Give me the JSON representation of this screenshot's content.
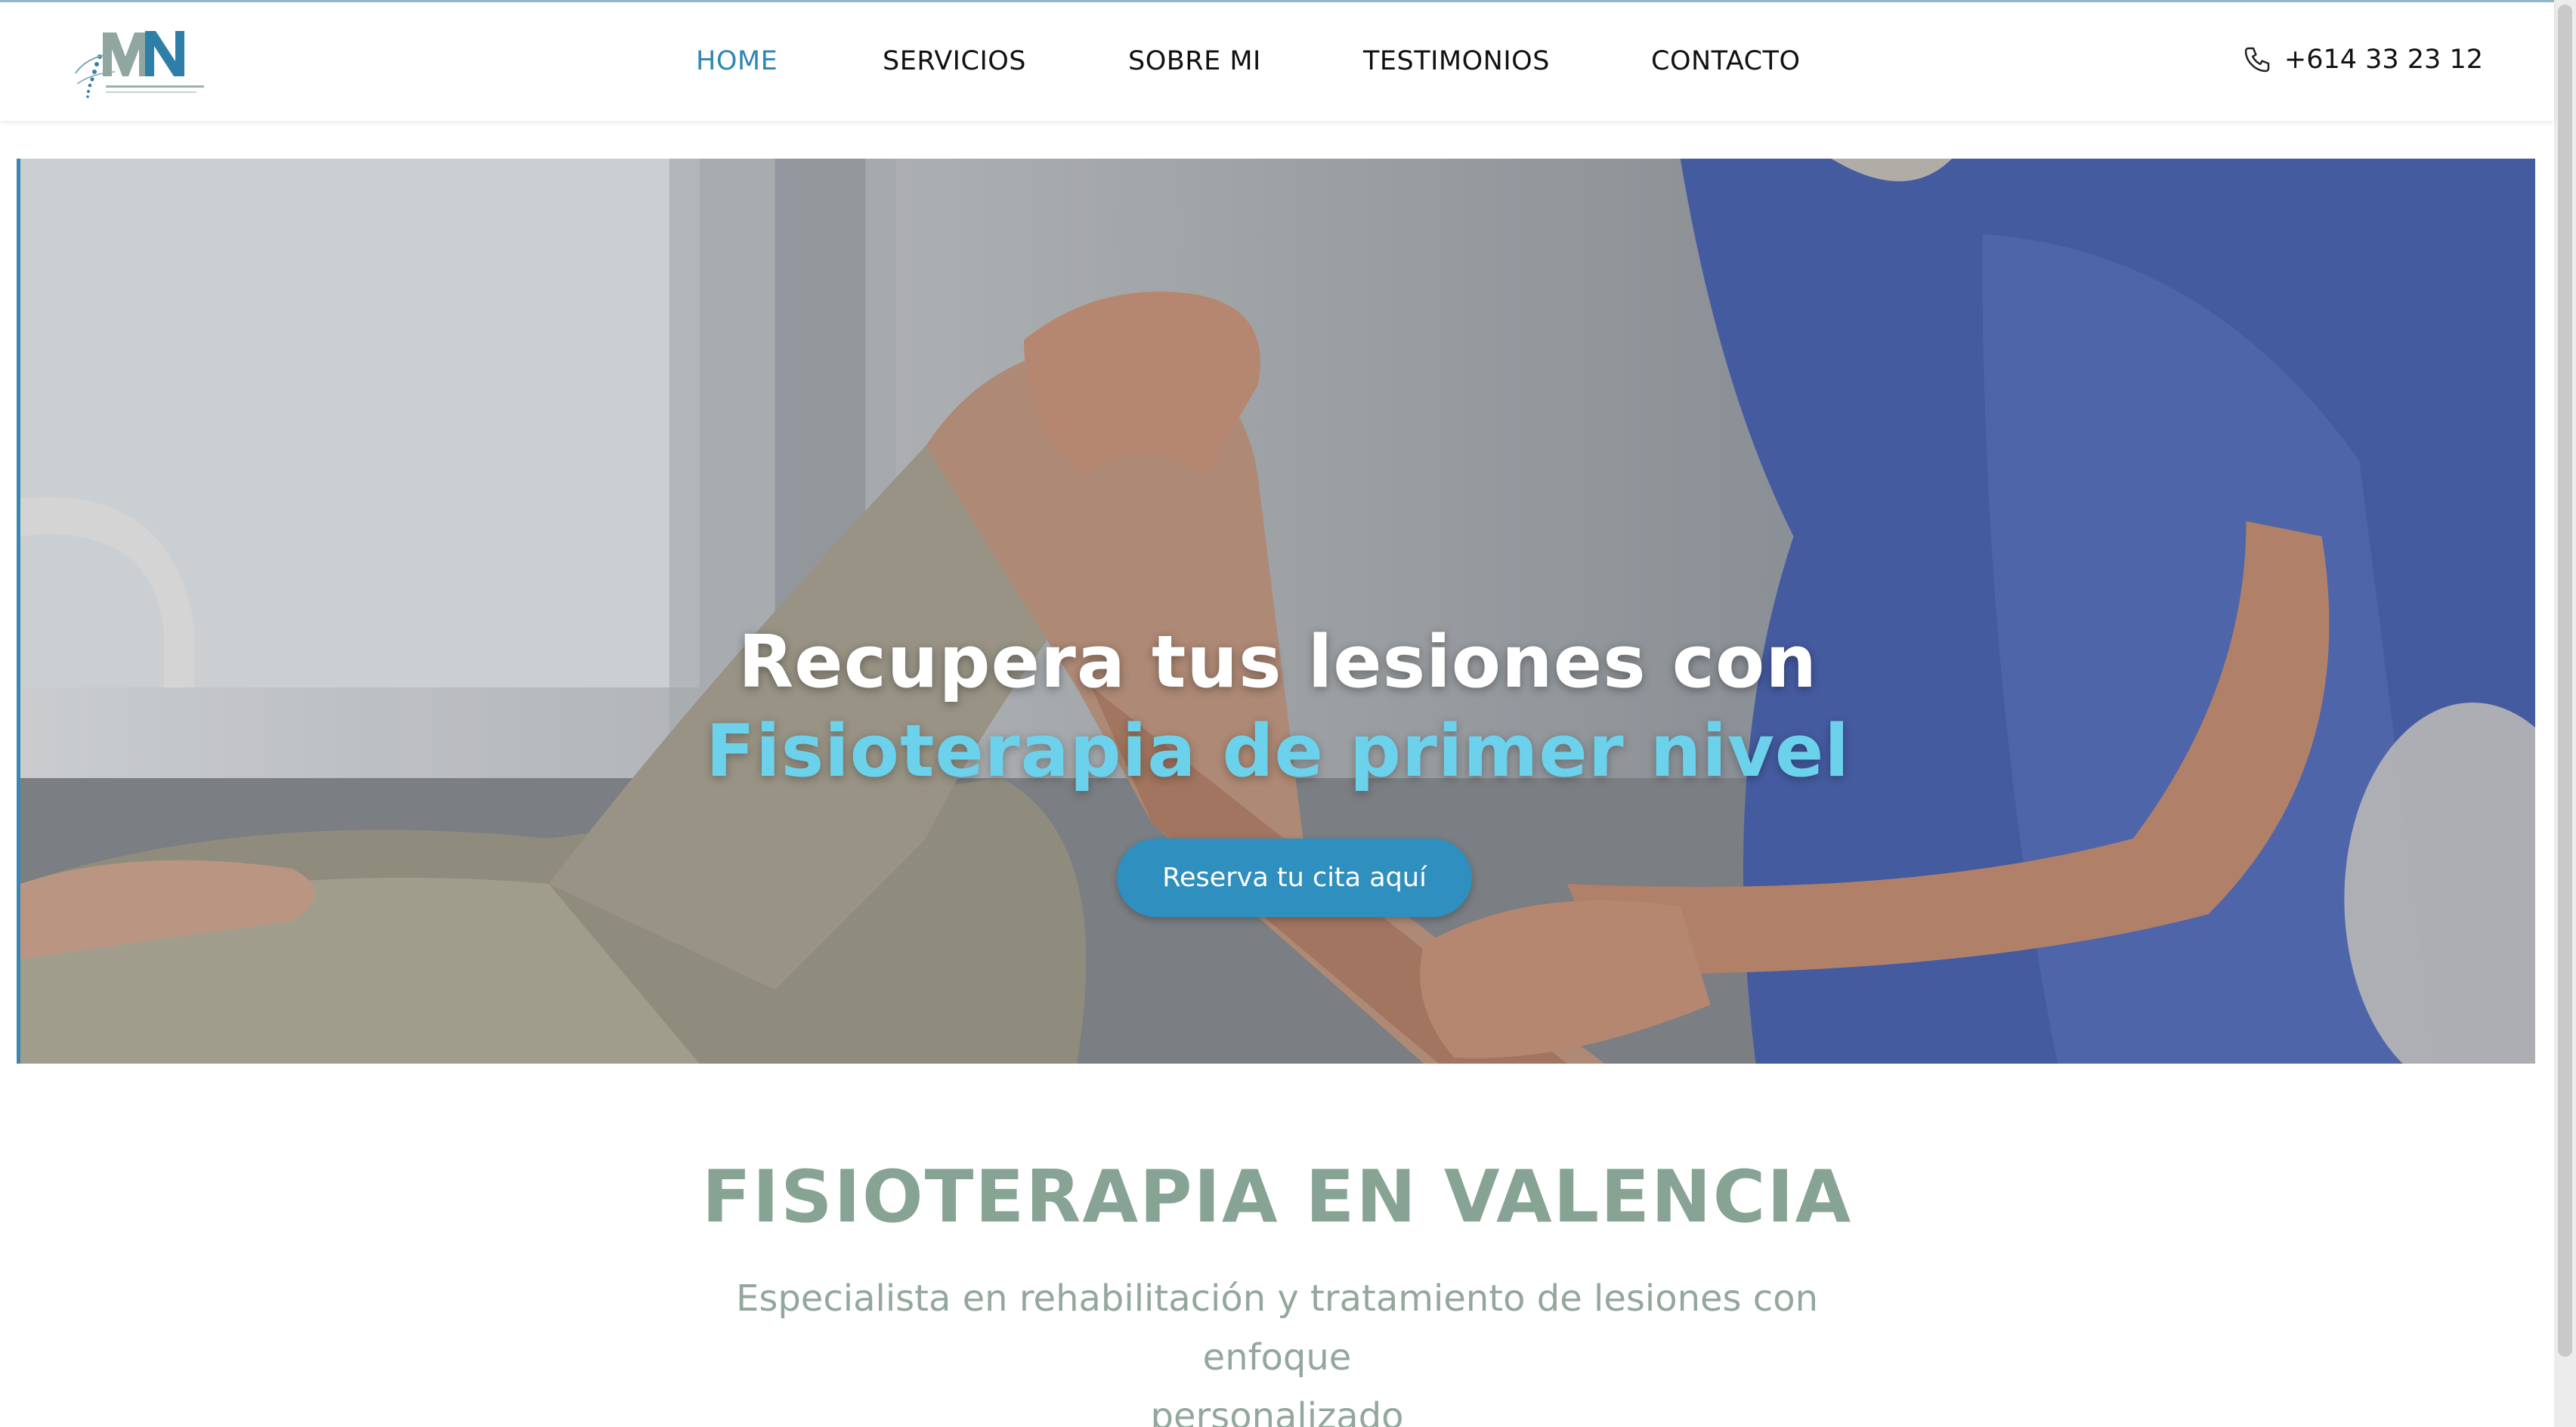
{
  "header": {
    "logo_alt": "MN",
    "nav": [
      {
        "label": "HOME",
        "active": true
      },
      {
        "label": "SERVICIOS",
        "active": false
      },
      {
        "label": "SOBRE MI",
        "active": false
      },
      {
        "label": "TESTIMONIOS",
        "active": false
      },
      {
        "label": "CONTACTO",
        "active": false
      }
    ],
    "phone": "+614 33 23 12",
    "phone_icon": "phone-icon"
  },
  "hero": {
    "line1": "Recupera tus lesiones con",
    "line2": "Fisioterapia de primer nivel",
    "cta_label": "Reserva tu cita aquí"
  },
  "section": {
    "title": "FISIOTERAPIA EN VALENCIA",
    "subtitle_line1": "Especialista en rehabilitación y tratamiento de lesiones con enfoque",
    "subtitle_line2": "personalizado"
  },
  "colors": {
    "accent": "#2e86b5",
    "hero_highlight": "#6cd2ec",
    "section_title": "#86a394",
    "cta_bg": "#2f8fbe"
  }
}
